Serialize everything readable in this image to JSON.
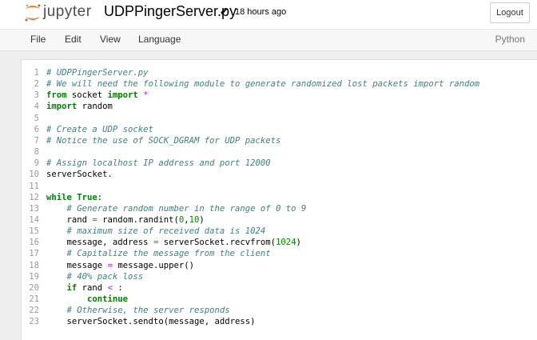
{
  "header": {
    "brand": "jupyter",
    "filename": "UDPPingerServer.py",
    "checkmark": "✔",
    "saved": "18 hours ago",
    "logout": "Logout"
  },
  "menu": {
    "items": [
      "File",
      "Edit",
      "View",
      "Language"
    ],
    "kernel": "Python"
  },
  "colors": {
    "logo_orange": "#f37726",
    "comment": "#408080",
    "keyword": "#008000",
    "operator": "#aa22ff"
  },
  "code_lines": [
    {
      "n": "1",
      "tokens": [
        {
          "c": "c",
          "t": "# UDPPingerServer.py"
        }
      ]
    },
    {
      "n": "2",
      "tokens": [
        {
          "c": "c",
          "t": "# We will need the following module to generate randomized lost packets import random"
        }
      ]
    },
    {
      "n": "3",
      "tokens": [
        {
          "c": "k",
          "t": "from"
        },
        {
          "c": "",
          "t": " socket "
        },
        {
          "c": "k",
          "t": "import"
        },
        {
          "c": "",
          "t": " "
        },
        {
          "c": "o",
          "t": "*"
        }
      ]
    },
    {
      "n": "4",
      "tokens": [
        {
          "c": "k",
          "t": "import"
        },
        {
          "c": "",
          "t": " random"
        }
      ]
    },
    {
      "n": "5",
      "tokens": []
    },
    {
      "n": "6",
      "tokens": [
        {
          "c": "c",
          "t": "# Create a UDP socket"
        }
      ]
    },
    {
      "n": "7",
      "tokens": [
        {
          "c": "c",
          "t": "# Notice the use of SOCK_DGRAM for UDP packets"
        }
      ]
    },
    {
      "n": "8",
      "tokens": []
    },
    {
      "n": "9",
      "tokens": [
        {
          "c": "c",
          "t": "# Assign localhost IP address and port 12000"
        }
      ]
    },
    {
      "n": "10",
      "tokens": [
        {
          "c": "",
          "t": "serverSocket."
        }
      ]
    },
    {
      "n": "11",
      "tokens": []
    },
    {
      "n": "12",
      "tokens": [
        {
          "c": "k",
          "t": "while"
        },
        {
          "c": "",
          "t": " "
        },
        {
          "c": "k",
          "t": "True"
        },
        {
          "c": "",
          "t": ":"
        }
      ]
    },
    {
      "n": "13",
      "tokens": [
        {
          "c": "",
          "t": "    "
        },
        {
          "c": "c",
          "t": "# Generate random number in the range of 0 to 9"
        }
      ]
    },
    {
      "n": "14",
      "tokens": [
        {
          "c": "",
          "t": "    rand "
        },
        {
          "c": "o",
          "t": "="
        },
        {
          "c": "",
          "t": " random.randint("
        },
        {
          "c": "n",
          "t": "0"
        },
        {
          "c": "",
          "t": ","
        },
        {
          "c": "n",
          "t": "10"
        },
        {
          "c": "",
          "t": ")"
        }
      ]
    },
    {
      "n": "15",
      "tokens": [
        {
          "c": "",
          "t": "    "
        },
        {
          "c": "c",
          "t": "# maximum size of received data is 1024"
        }
      ]
    },
    {
      "n": "16",
      "tokens": [
        {
          "c": "",
          "t": "    message, address "
        },
        {
          "c": "o",
          "t": "="
        },
        {
          "c": "",
          "t": " serverSocket.recvfrom("
        },
        {
          "c": "n",
          "t": "1024"
        },
        {
          "c": "",
          "t": ")"
        }
      ]
    },
    {
      "n": "17",
      "tokens": [
        {
          "c": "",
          "t": "    "
        },
        {
          "c": "c",
          "t": "# Capitalize the message from the client"
        }
      ]
    },
    {
      "n": "18",
      "tokens": [
        {
          "c": "",
          "t": "    message "
        },
        {
          "c": "o",
          "t": "="
        },
        {
          "c": "",
          "t": " message.upper()"
        }
      ]
    },
    {
      "n": "19",
      "tokens": [
        {
          "c": "",
          "t": "    "
        },
        {
          "c": "c",
          "t": "# 40% pack loss"
        }
      ]
    },
    {
      "n": "20",
      "tokens": [
        {
          "c": "",
          "t": "    "
        },
        {
          "c": "k",
          "t": "if"
        },
        {
          "c": "",
          "t": " rand "
        },
        {
          "c": "o",
          "t": "<"
        },
        {
          "c": "",
          "t": " :"
        }
      ]
    },
    {
      "n": "21",
      "tokens": [
        {
          "c": "",
          "t": "        "
        },
        {
          "c": "k",
          "t": "continue"
        }
      ]
    },
    {
      "n": "22",
      "tokens": [
        {
          "c": "",
          "t": "    "
        },
        {
          "c": "c",
          "t": "# Otherwise, the server responds"
        }
      ]
    },
    {
      "n": "23",
      "tokens": [
        {
          "c": "",
          "t": "    serverSocket.sendto(message, address)"
        }
      ]
    }
  ]
}
